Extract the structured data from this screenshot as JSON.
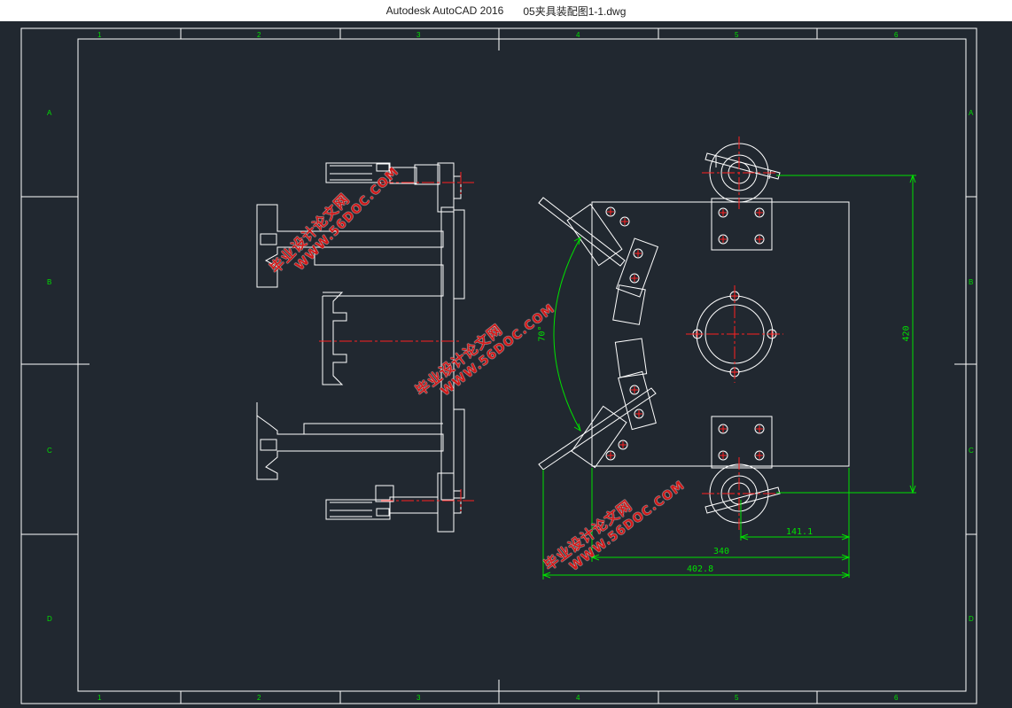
{
  "window": {
    "app_title": "Autodesk AutoCAD 2016",
    "file_name": "05夹具装配图1-1.dwg"
  },
  "drawing": {
    "colors": {
      "background": "#212830",
      "lines": "#ffffff",
      "dimensions": "#00ff00",
      "centerlines": "#ff2020",
      "watermark": "#d01a1a"
    },
    "column_labels_top": [
      "1",
      "2",
      "3",
      "4",
      "5",
      "6"
    ],
    "column_labels_bottom": [
      "1",
      "2",
      "3",
      "4",
      "5",
      "6"
    ],
    "row_labels_left": [
      "A",
      "B",
      "C",
      "D"
    ],
    "row_labels_right": [
      "A",
      "B",
      "C",
      "D"
    ],
    "dimensions": {
      "d_141": "141.1",
      "d_340": "340",
      "d_402": "402.8",
      "d_vertical": "420",
      "d_arc": "70°"
    },
    "watermark": {
      "line1": "毕业设计论文网",
      "line2": "WWW.56DOC.COM"
    }
  }
}
